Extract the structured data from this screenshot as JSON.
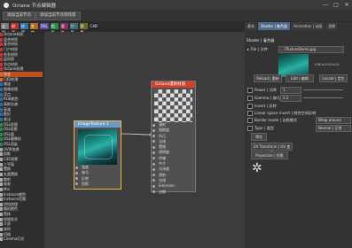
{
  "app": {
    "title": "Octane 节点编辑器"
  },
  "window_buttons": [
    "—",
    "□",
    "✕"
  ],
  "toolbar": {
    "btn1": "添加当前节点",
    "btn2": "添加当前节点到场景"
  },
  "filter_tags": [
    {
      "label": "全部",
      "color": "#7a7a7a"
    },
    {
      "label": "材质",
      "color": "#b33"
    },
    {
      "label": "纹理",
      "color": "#2a7ab0"
    },
    {
      "label": "发射",
      "color": "#b06a20"
    },
    {
      "label": "OSL",
      "color": "#5c4aa0"
    },
    {
      "label": "相机",
      "color": "#2a8a4a"
    },
    {
      "label": "渲染",
      "color": "#8a2a6a"
    },
    {
      "label": "介质",
      "color": "#3a7070"
    },
    {
      "label": "投影",
      "color": "#6a6a20"
    },
    {
      "label": "C4D",
      "color": "#222"
    }
  ],
  "sidebar_items": [
    {
      "label": "Octane材质",
      "color": "#c33"
    },
    {
      "label": "混合材质",
      "color": "#c33"
    },
    {
      "label": "复合材质",
      "color": "#c33"
    },
    {
      "label": "门户材质",
      "color": "#c33"
    },
    {
      "label": "毛发材质",
      "color": "#c33"
    },
    {
      "label": "层材质",
      "color": "#c33"
    },
    {
      "label": "节点材质",
      "color": "#c33"
    },
    {
      "label": "Octane纹理",
      "color": "#c33"
    },
    {
      "label": "渐变",
      "color": "#d07020"
    },
    {
      "label": "C4D纹理",
      "color": "#d07020"
    },
    {
      "label": "噪波",
      "color": "#2a6aaa"
    },
    {
      "label": "图像纹理",
      "color": "#2a6aaa"
    },
    {
      "label": "浮点",
      "color": "#2a6aaa"
    },
    {
      "label": "RGB颜色",
      "color": "#2a6aaa"
    },
    {
      "label": "高斯光谱",
      "color": "#2a6aaa"
    },
    {
      "label": "衰减",
      "color": "#2a6aaa"
    },
    {
      "label": "脏旧",
      "color": "#2a6aaa"
    },
    {
      "label": "乘法",
      "color": "#2a6aaa"
    },
    {
      "label": "OSL纹理",
      "color": "#2a8a4a"
    },
    {
      "label": "OSL投影",
      "color": "#2a8a4a"
    },
    {
      "label": "OSL值",
      "color": "#2a8a4a"
    },
    {
      "label": "OSL摄像机",
      "color": "#2a8a4a"
    },
    {
      "label": "OSL渲染",
      "color": "#2a8a4a"
    },
    {
      "label": "UVW变换",
      "color": "#aaa"
    },
    {
      "label": "投影",
      "color": "#aaa"
    },
    {
      "label": "C4D投影",
      "color": "#aaa"
    },
    {
      "label": "三平面",
      "color": "#aaa"
    },
    {
      "label": "置换",
      "color": "#aaa"
    },
    {
      "label": "矢量置换",
      "color": "#aaa"
    },
    {
      "label": "散射",
      "color": "#aaa"
    },
    {
      "label": "吸收",
      "color": "#aaa"
    },
    {
      "label": "Mix",
      "color": "#aaa"
    },
    {
      "label": "Instance颜色",
      "color": "#aaa"
    },
    {
      "label": "Instance范围",
      "color": "#aaa"
    },
    {
      "label": "烘焙纹理",
      "color": "#aaa"
    },
    {
      "label": "随机颜色",
      "color": "#aaa"
    },
    {
      "label": "黑体",
      "color": "#aaa"
    },
    {
      "label": "纹理发光",
      "color": "#aaa"
    },
    {
      "label": "介质",
      "color": "#aaa"
    },
    {
      "label": "体积",
      "color": "#aaa"
    },
    {
      "label": "扫描",
      "color": "#aaa"
    },
    {
      "label": "Cinema灯光",
      "color": "#aaa"
    }
  ],
  "image_node": {
    "title": "ImageTexture 1",
    "pins": [
      "强度",
      "伽马",
      "反转",
      "投影"
    ]
  },
  "mat_node": {
    "title": "Octane漫射材质",
    "pins": [
      "漫射",
      "粗糙度",
      "凹凸",
      "法线",
      "置换",
      "透明度",
      "传输",
      "中介",
      "光泽度",
      "透射",
      "光线",
      "Emission",
      "边缘"
    ]
  },
  "right_panel": {
    "tabs": [
      "基本",
      "Shader | 着色器",
      "Animation | 动画",
      "投影"
    ],
    "section": "Shader | 着色器",
    "file_label": "File | 文件",
    "file_value": "...\\TextureDemo.jpg",
    "image_info": "1080x1920x24",
    "buttons": {
      "reload": "Reload | 重新",
      "edit": "Edit | 编辑",
      "locate": "Locate | 定位"
    },
    "power_label": "Power | 功率",
    "power_value": "1.",
    "gamma_label": "Gamma | 伽马",
    "gamma_value": "2.2",
    "invert_label": "Invert | 反转",
    "linear_label": "Linear space invert | 线性空间反转",
    "border_label": "Border mode | 边框模式",
    "border_value": "Wrap around",
    "type_label": "Type | 类型",
    "type_value": "Normal | 正常",
    "footer_btn": "预览",
    "uv_transform": "UV Transform | UV 变换",
    "projection": "Projection | 投影"
  }
}
